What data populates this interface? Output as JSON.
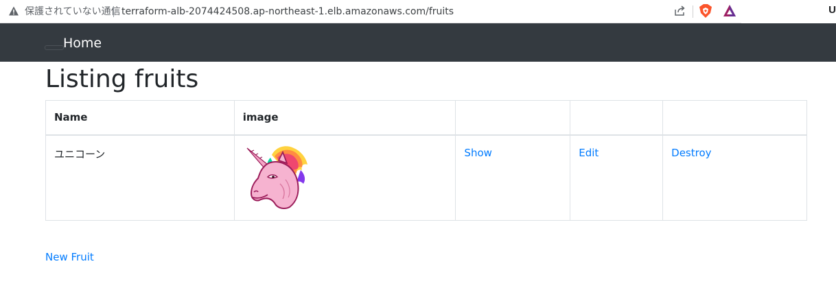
{
  "browser": {
    "security_label": "保護されていない通信",
    "url": "terraform-alb-2074424508.ap-northeast-1.elb.amazonaws.com/fruits",
    "right_char": "U",
    "icons": [
      "warning-icon",
      "share-icon",
      "brave-shield-icon",
      "bat-rewards-icon"
    ]
  },
  "navbar": {
    "brand": "Home",
    "background": "#343a40"
  },
  "page": {
    "title": "Listing fruits"
  },
  "table": {
    "headers": [
      "Name",
      "image",
      "",
      "",
      ""
    ],
    "rows": [
      {
        "name": "ユニコーン",
        "image_icon": "unicorn-image",
        "show": "Show",
        "edit": "Edit",
        "destroy": "Destroy"
      }
    ]
  },
  "footer_links": {
    "new_fruit": "New Fruit"
  },
  "colors": {
    "link": "#007bff",
    "text": "#212529",
    "border": "#dee2e6"
  }
}
